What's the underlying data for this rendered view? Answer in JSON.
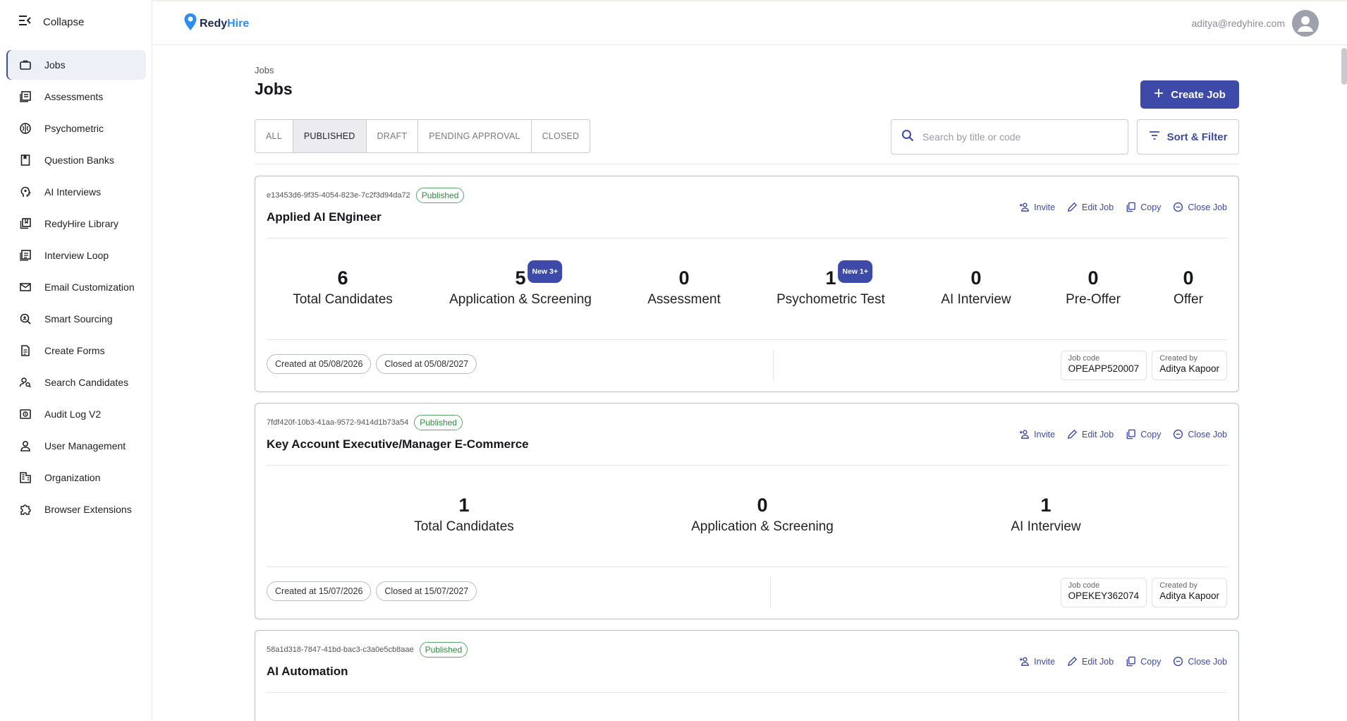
{
  "sidebar": {
    "collapse_label": "Collapse",
    "items": [
      {
        "label": "Jobs",
        "icon": "briefcase-icon",
        "active": true
      },
      {
        "label": "Assessments",
        "icon": "assessment-icon"
      },
      {
        "label": "Psychometric",
        "icon": "brain-icon"
      },
      {
        "label": "Question Banks",
        "icon": "book-icon"
      },
      {
        "label": "AI Interviews",
        "icon": "ai-head-icon"
      },
      {
        "label": "RedyHire Library",
        "icon": "library-icon"
      },
      {
        "label": "Interview Loop",
        "icon": "list-icon"
      },
      {
        "label": "Email Customization",
        "icon": "mail-icon"
      },
      {
        "label": "Smart Sourcing",
        "icon": "sourcing-icon"
      },
      {
        "label": "Create Forms",
        "icon": "form-icon"
      },
      {
        "label": "Search Candidates",
        "icon": "person-search-icon"
      },
      {
        "label": "Audit Log V2",
        "icon": "audit-icon"
      },
      {
        "label": "User Management",
        "icon": "user-icon"
      },
      {
        "label": "Organization",
        "icon": "building-icon"
      },
      {
        "label": "Browser Extensions",
        "icon": "puzzle-icon"
      }
    ]
  },
  "header": {
    "logo_redy": "Redy",
    "logo_hire": "Hire",
    "user_email": "aditya@redyhire.com"
  },
  "page": {
    "breadcrumb": "Jobs",
    "title": "Jobs",
    "create_label": "Create Job",
    "tabs": [
      {
        "label": "ALL"
      },
      {
        "label": "PUBLISHED",
        "active": true
      },
      {
        "label": "DRAFT"
      },
      {
        "label": "PENDING APPROVAL"
      },
      {
        "label": "CLOSED"
      }
    ],
    "search_placeholder": "Search by title or code",
    "filter_label": "Sort & Filter"
  },
  "actions": {
    "invite": "Invite",
    "edit": "Edit Job",
    "copy": "Copy",
    "close": "Close Job"
  },
  "meta_labels": {
    "job_code": "Job code",
    "created_by": "Created by"
  },
  "jobs": [
    {
      "id": "e13453d6-9f35-4054-823e-7c2f3d94da72",
      "status": "Published",
      "title": "Applied AI ENgineer",
      "stats": [
        {
          "value": "6",
          "label": "Total Candidates"
        },
        {
          "value": "5",
          "label": "Application & Screening",
          "badge": "New 3+"
        },
        {
          "value": "0",
          "label": "Assessment"
        },
        {
          "value": "1",
          "label": "Psychometric Test",
          "badge": "New 1+"
        },
        {
          "value": "0",
          "label": "AI Interview"
        },
        {
          "value": "0",
          "label": "Pre-Offer"
        },
        {
          "value": "0",
          "label": "Offer"
        }
      ],
      "created_at": "Created at 05/08/2026",
      "closed_at": "Closed at 05/08/2027",
      "job_code": "OPEAPP520007",
      "created_by": "Aditya Kapoor"
    },
    {
      "id": "7fdf420f-10b3-41aa-9572-9414d1b73a54",
      "status": "Published",
      "title": "Key Account Executive/Manager E-Commerce",
      "stats": [
        {
          "value": "1",
          "label": "Total Candidates"
        },
        {
          "value": "0",
          "label": "Application & Screening"
        },
        {
          "value": "1",
          "label": "AI Interview"
        }
      ],
      "created_at": "Created at 15/07/2026",
      "closed_at": "Closed at 15/07/2027",
      "job_code": "OPEKEY362074",
      "created_by": "Aditya Kapoor"
    },
    {
      "id": "58a1d318-7847-41bd-bac3-c3a0e5cb8aae",
      "status": "Published",
      "title": "AI Automation"
    }
  ]
}
